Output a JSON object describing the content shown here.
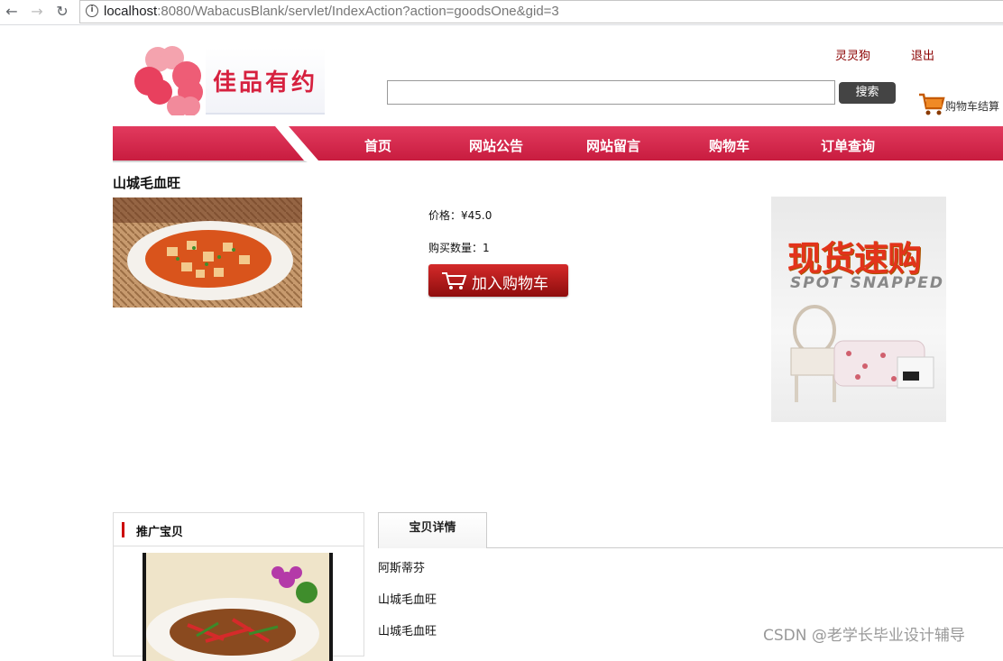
{
  "browser": {
    "url_host": "localhost",
    "url_rest": ":8080/WabacusBlank/servlet/IndexAction?action=goodsOne&gid=3"
  },
  "header": {
    "logo_text": "佳品有约",
    "user_name": "灵灵狗",
    "logout": "退出",
    "search_placeholder": "",
    "search_button": "搜索",
    "cart_checkout": "购物车结算"
  },
  "nav": {
    "items": [
      "首页",
      "网站公告",
      "网站留言",
      "购物车",
      "订单查询"
    ]
  },
  "product": {
    "title": "山城毛血旺",
    "price_label": "价格：¥45.0",
    "qty_label": "购买数量：1",
    "add_to_cart": "加入购物车"
  },
  "banner": {
    "headline": "现货速购",
    "subline": "SPOT SNAPPED"
  },
  "promo": {
    "title": "推广宝贝"
  },
  "details": {
    "tab": "宝贝详情",
    "lines": [
      "阿斯蒂芬",
      "山城毛血旺",
      "山城毛血旺"
    ]
  },
  "watermark": "CSDN @老学长毕业设计辅导",
  "colors": {
    "nav_red": "#d9264a",
    "brand_red": "#d6213f",
    "link_dark_red": "#8b0000"
  }
}
